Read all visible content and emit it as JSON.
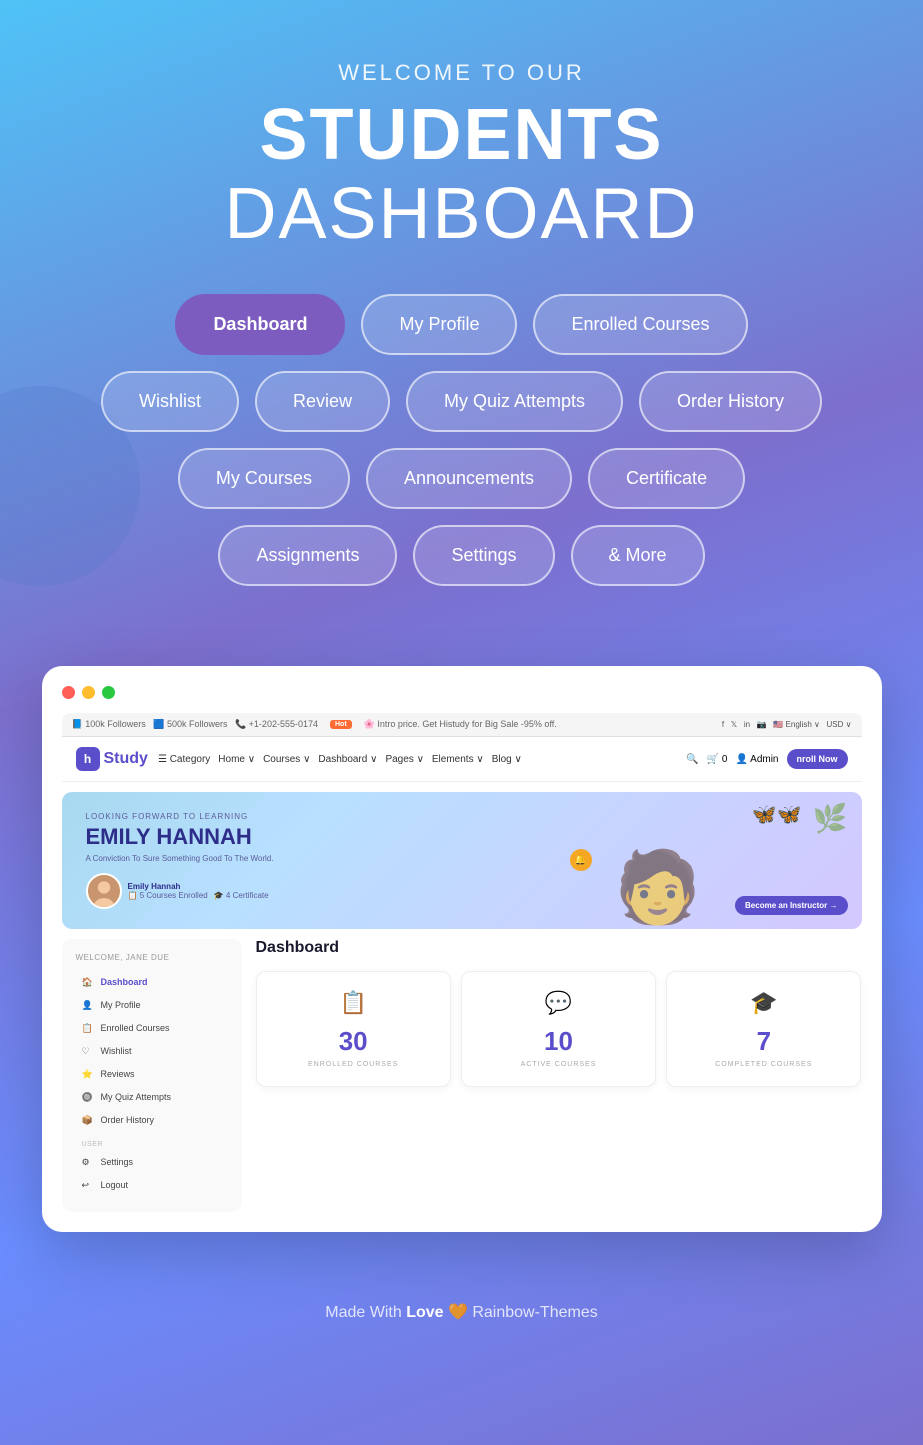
{
  "hero": {
    "subtitle": "WELCOME TO OUR",
    "title_bold": "STUDENTS",
    "title_light": " DASHBOARD"
  },
  "nav": {
    "rows": [
      [
        {
          "label": "Dashboard",
          "active": true
        },
        {
          "label": "My Profile",
          "active": false
        },
        {
          "label": "Enrolled Courses",
          "active": false
        }
      ],
      [
        {
          "label": "Wishlist",
          "active": false
        },
        {
          "label": "Review",
          "active": false
        },
        {
          "label": "My Quiz Attempts",
          "active": false
        },
        {
          "label": "Order History",
          "active": false
        }
      ],
      [
        {
          "label": "My Courses",
          "active": false
        },
        {
          "label": "Announcements",
          "active": false
        },
        {
          "label": "Certificate",
          "active": false
        }
      ],
      [
        {
          "label": "Assignments",
          "active": false
        },
        {
          "label": "Settings",
          "active": false
        },
        {
          "label": "& More",
          "active": false
        }
      ]
    ]
  },
  "preview": {
    "topbar": {
      "left": "100k Followers   500k Followers   +1-202-555-0174",
      "hot_label": "Hot",
      "promo": "Intro price. Get Histudy for Big Sale -95% off.",
      "right": "English ∨   USD ∨"
    },
    "navbar": {
      "logo": "Study",
      "category": "Category",
      "items": [
        "Home ∨",
        "Courses ∨",
        "Dashboard ∨",
        "Pages ∨",
        "Elements ∨",
        "Blog ∨"
      ],
      "admin": "Admin",
      "enroll": "nroll Now"
    },
    "banner": {
      "looking": "LOOKING FORWARD TO LEARNING",
      "name": "EMILY HANNAH",
      "tagline": "A Conviction To Sure Something Good To The World.",
      "user_name": "Emily Hannah",
      "courses_enrolled": "5 Courses Enrolled",
      "certificates": "4 Certificate",
      "cta": "Become an Instructor →"
    },
    "sidebar": {
      "welcome": "WELCOME, JANE DUE",
      "items": [
        {
          "icon": "🏠",
          "label": "Dashboard",
          "active": true
        },
        {
          "icon": "👤",
          "label": "My Profile",
          "active": false
        },
        {
          "icon": "📋",
          "label": "Enrolled Courses",
          "active": false
        },
        {
          "icon": "♡",
          "label": "Wishlist",
          "active": false
        },
        {
          "icon": "⭐",
          "label": "Reviews",
          "active": false
        },
        {
          "icon": "🔘",
          "label": "My Quiz Attempts",
          "active": false
        },
        {
          "icon": "📦",
          "label": "Order History",
          "active": false
        }
      ],
      "section_label": "USER",
      "user_items": [
        {
          "icon": "⚙",
          "label": "Settings"
        },
        {
          "icon": "↩",
          "label": "Logout"
        }
      ]
    },
    "stats": {
      "title": "Dashboard",
      "cards": [
        {
          "icon": "📋",
          "number": "30",
          "label": "ENROLLED COURSES"
        },
        {
          "icon": "💬",
          "number": "10",
          "label": "ACTIVE COURSES"
        },
        {
          "icon": "🎓",
          "number": "7",
          "label": "COMPLETED COURSES"
        }
      ]
    }
  },
  "footer": {
    "text": "Made With",
    "bold": "Love",
    "emoji": "🧡",
    "brand": "Rainbow-Themes"
  }
}
